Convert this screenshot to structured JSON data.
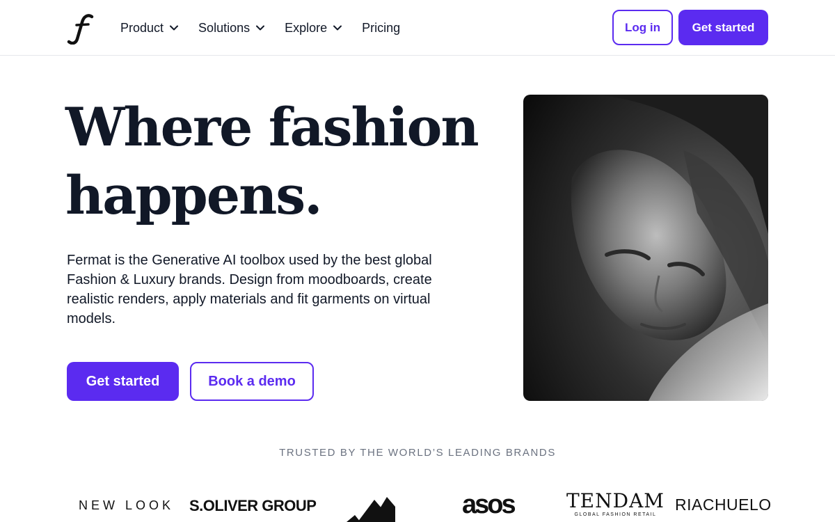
{
  "header": {
    "logo": "fermat-logo",
    "nav": [
      {
        "label": "Product",
        "has_dropdown": true
      },
      {
        "label": "Solutions",
        "has_dropdown": true
      },
      {
        "label": "Explore",
        "has_dropdown": true
      },
      {
        "label": "Pricing",
        "has_dropdown": false
      }
    ],
    "login_label": "Log in",
    "get_started_label": "Get started"
  },
  "hero": {
    "title_line1": "Where fashion",
    "title_line2": "happens.",
    "description": "Fermat is the Generative AI toolbox used by the best global Fashion & Luxury brands. Design from moodboards, create realistic renders, apply materials and fit garments on virtual models.",
    "primary_cta": "Get started",
    "secondary_cta": "Book a demo",
    "image": "black-and-white-portrait-photo"
  },
  "trusted": {
    "heading": "TRUSTED BY THE WORLD’S LEADING BRANDS",
    "brands": {
      "newlook": "NEW LOOK",
      "soliver": "S.OLIVER GROUP",
      "adidas": "adidas-logo",
      "asos": "asos",
      "tendam": "TENDAM",
      "tendam_sub": "GLOBAL FASHION RETAIL",
      "riachuelo": "RIACHUELO"
    }
  },
  "colors": {
    "accent": "#5b2bf0",
    "text": "#111827",
    "muted": "#6b7280",
    "border": "#e5e7eb"
  }
}
